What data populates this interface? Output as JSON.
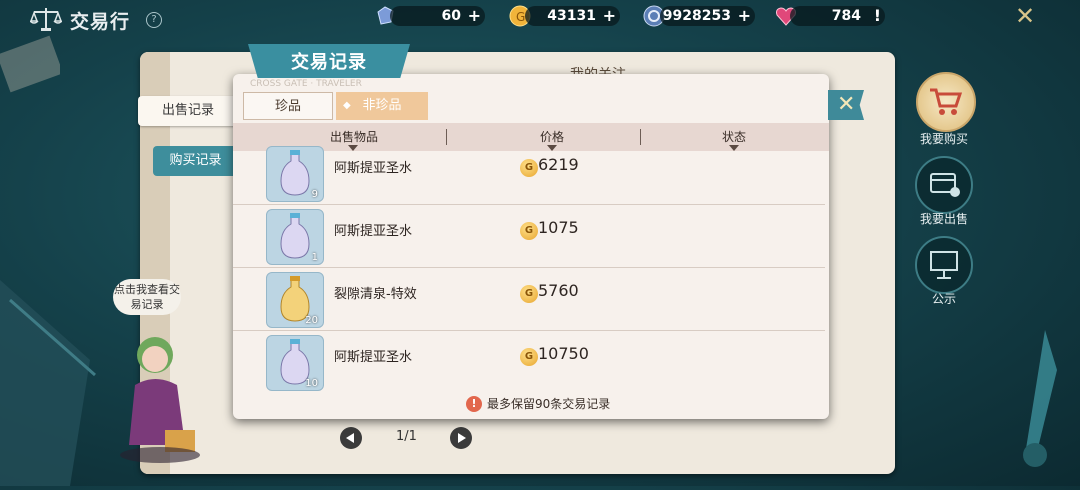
{
  "header": {
    "title": "交易行",
    "help_icon": "question-circle-icon"
  },
  "resources": [
    {
      "name": "crystal",
      "value": "60",
      "icon": "crystal-icon",
      "has_plus": true
    },
    {
      "name": "gold",
      "value": "43131",
      "icon": "gold-coin-icon",
      "has_plus": true
    },
    {
      "name": "token",
      "value": "9928253",
      "icon": "token-coin-icon",
      "has_plus": true
    },
    {
      "name": "heart",
      "value": "784",
      "icon": "heart-icon",
      "suffix": "!"
    }
  ],
  "background_panel": {
    "left_tabs": [
      "出售记录",
      "购买记录"
    ],
    "title": "我的关注",
    "pager": "1/1"
  },
  "dialog": {
    "title": "交易记录",
    "watermark": "CROSS GATE · TRAVELER",
    "tabs": [
      "珍品",
      "非珍品"
    ],
    "active_tab": "非珍品",
    "columns": [
      "出售物品",
      "价格",
      "状态"
    ],
    "rows": [
      {
        "name": "阿斯提亚圣水",
        "qty": "9",
        "price": "6219",
        "icon": "holy-water-bottle-icon"
      },
      {
        "name": "阿斯提亚圣水",
        "qty": "1",
        "price": "1075",
        "icon": "holy-water-bottle-icon"
      },
      {
        "name": "裂隙清泉-特效",
        "qty": "20",
        "price": "5760",
        "icon": "golden-potion-bottle-icon"
      },
      {
        "name": "阿斯提亚圣水",
        "qty": "10",
        "price": "10750",
        "icon": "holy-water-bottle-icon"
      }
    ],
    "coin_glyph": "G",
    "notice": "最多保留90条交易记录"
  },
  "side_menu": [
    {
      "label": "我要购买",
      "icon": "shopping-cart-icon"
    },
    {
      "label": "我要出售",
      "icon": "sell-card-icon"
    },
    {
      "label": "公示",
      "icon": "notice-board-icon"
    }
  ],
  "npc": {
    "bubble": "点击我查看交易记录"
  },
  "colors": {
    "accent": "#3a8fa0",
    "tab_active": "#f0c89b",
    "header_row": "#e7d7d1",
    "dialog_bg": "#f7f1ec"
  }
}
